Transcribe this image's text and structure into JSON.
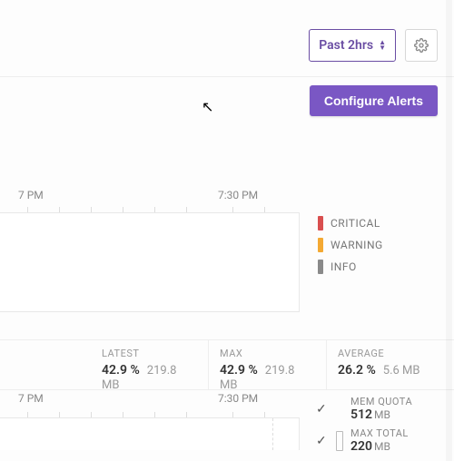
{
  "toolbar": {
    "time_range": "Past 2hrs",
    "configure_alerts": "Configure Alerts"
  },
  "legend": {
    "critical": "CRITICAL",
    "warning": "WARNING",
    "info": "INFO"
  },
  "stats": {
    "latest": {
      "label": "LATEST",
      "pct": "42.9 %",
      "mb": "219.8 MB"
    },
    "max": {
      "label": "MAX",
      "pct": "42.9 %",
      "mb": "219.8 MB"
    },
    "avg": {
      "label": "AVERAGE",
      "pct": "26.2 %",
      "mb": "5.6 MB"
    }
  },
  "mem": {
    "quota": {
      "label": "MEM QUOTA",
      "value": "512",
      "unit": "MB"
    },
    "maxtotal": {
      "label": "MAX TOTAL",
      "value": "220",
      "unit": "MB"
    }
  },
  "chart_data": [
    {
      "type": "bar",
      "title": "",
      "x_ticks": [
        "7 PM",
        "7:30 PM"
      ],
      "series": [
        {
          "name": "CRITICAL",
          "color": "#d94f4f",
          "values": []
        },
        {
          "name": "WARNING",
          "color": "#f4a933",
          "values": []
        },
        {
          "name": "INFO",
          "color": "#8a8a8a",
          "values": []
        }
      ]
    },
    {
      "type": "line",
      "title": "",
      "x_ticks": [
        "7 PM",
        "7:30 PM"
      ],
      "ylim": [
        0,
        512
      ],
      "unit": "MB",
      "series": [
        {
          "name": "MEM QUOTA",
          "value": 512
        },
        {
          "name": "MAX TOTAL",
          "value": 220
        }
      ]
    }
  ]
}
